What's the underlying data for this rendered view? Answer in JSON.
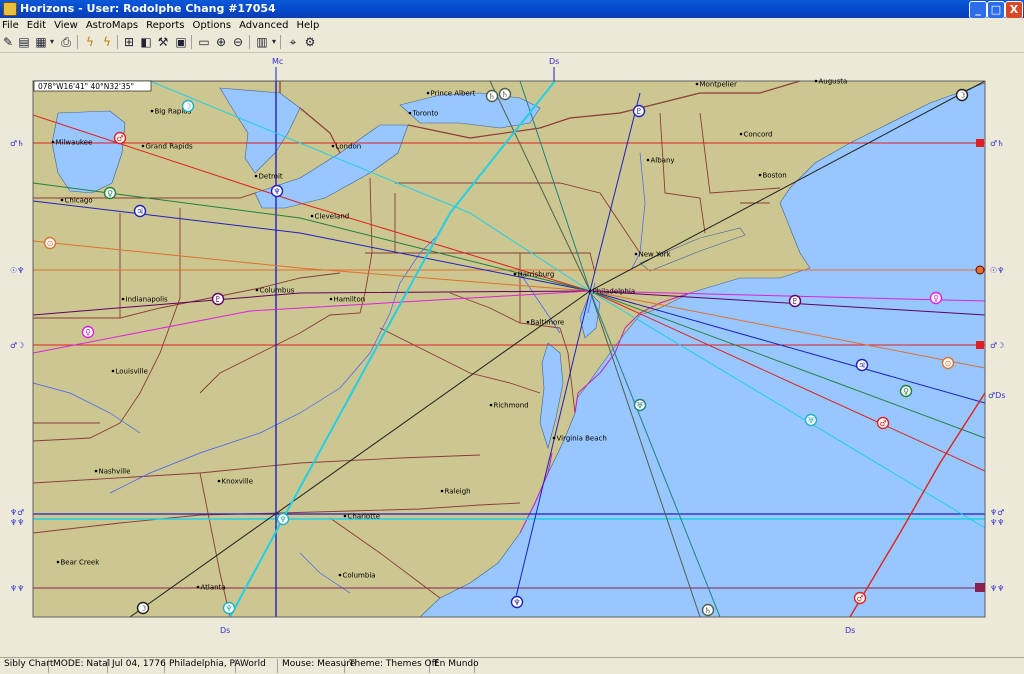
{
  "window": {
    "title": "Horizons - User: Rodolphe Chang #17054",
    "minimize": "_",
    "maximize": "□",
    "close": "X"
  },
  "menu": [
    "File",
    "Edit",
    "View",
    "AstroMaps",
    "Reports",
    "Options",
    "Advanced",
    "Help"
  ],
  "toolbar_icons": [
    "pencil-icon",
    "chart-icon",
    "edit-chart-icon",
    "dropdown-arrow-icon",
    "print-icon",
    "bolt-icon",
    "bolt-alt-icon",
    "map-icon",
    "layers-icon",
    "tools-icon",
    "gallery-icon",
    "map-view-icon",
    "zoom-in-icon",
    "zoom-out-icon",
    "grid-icon",
    "dropdown-arrow-icon",
    "crosshair-icon",
    "settings-icon"
  ],
  "map": {
    "coordinates": "078°W16'41\"   40°N32'35\"",
    "colors": {
      "land": "#CCC690",
      "water": "#98C6FF",
      "background": "#ECE9D8",
      "border": "#8B3A3A",
      "line_red": "#E02020",
      "line_blue": "#2020C0",
      "line_cyan": "#20D0E8"
    },
    "top_labels": {
      "mc": "Mc",
      "ds": "Ds"
    },
    "bottom_labels": {
      "ds1": "Ds",
      "ds2": "Ds"
    },
    "right_labels": {
      "ds": "♂Ds"
    },
    "edge_labels_left": [
      "♂♄",
      "☉♆",
      "♂☽",
      "♆♂",
      "♆♆",
      "♆♆"
    ],
    "edge_labels_right": [
      "♂♄",
      "☉♆",
      "♂☽",
      "♆♂",
      "♆♆",
      "♆♆"
    ],
    "glyphs": [
      "☉",
      "♂",
      "♀",
      "♃",
      "♄",
      "♅",
      "♆",
      "♇",
      "☽",
      "☿",
      "⊙"
    ],
    "cities": [
      {
        "name": "Big Rapids"
      },
      {
        "name": "Grand Rapids"
      },
      {
        "name": "Milwaukee"
      },
      {
        "name": "Chicago"
      },
      {
        "name": "Detroit"
      },
      {
        "name": "London"
      },
      {
        "name": "Prince Albert"
      },
      {
        "name": "Toronto"
      },
      {
        "name": "Cleveland"
      },
      {
        "name": "Montpelier"
      },
      {
        "name": "Augusta"
      },
      {
        "name": "Concord"
      },
      {
        "name": "Albany"
      },
      {
        "name": "Boston"
      },
      {
        "name": "New York"
      },
      {
        "name": "Harrisburg"
      },
      {
        "name": "Philadelphia"
      },
      {
        "name": "Columbus"
      },
      {
        "name": "Indianapolis"
      },
      {
        "name": "Hamilton"
      },
      {
        "name": "Baltimore"
      },
      {
        "name": "Louisville"
      },
      {
        "name": "Richmond"
      },
      {
        "name": "Virginia Beach"
      },
      {
        "name": "Nashville"
      },
      {
        "name": "Knoxville"
      },
      {
        "name": "Raleigh"
      },
      {
        "name": "Charlotte"
      },
      {
        "name": "Bear Creek"
      },
      {
        "name": "Columbia"
      },
      {
        "name": "Atlanta"
      }
    ]
  },
  "status": {
    "chart": "Sibly Chart",
    "mode": "MODE: Natal",
    "date": "Jul 04, 1776",
    "place": "Philadelphia, PA",
    "view": "World",
    "mouse": "Mouse: Measure",
    "theme": "Theme: Themes Off",
    "mundo": "En Mundo"
  }
}
